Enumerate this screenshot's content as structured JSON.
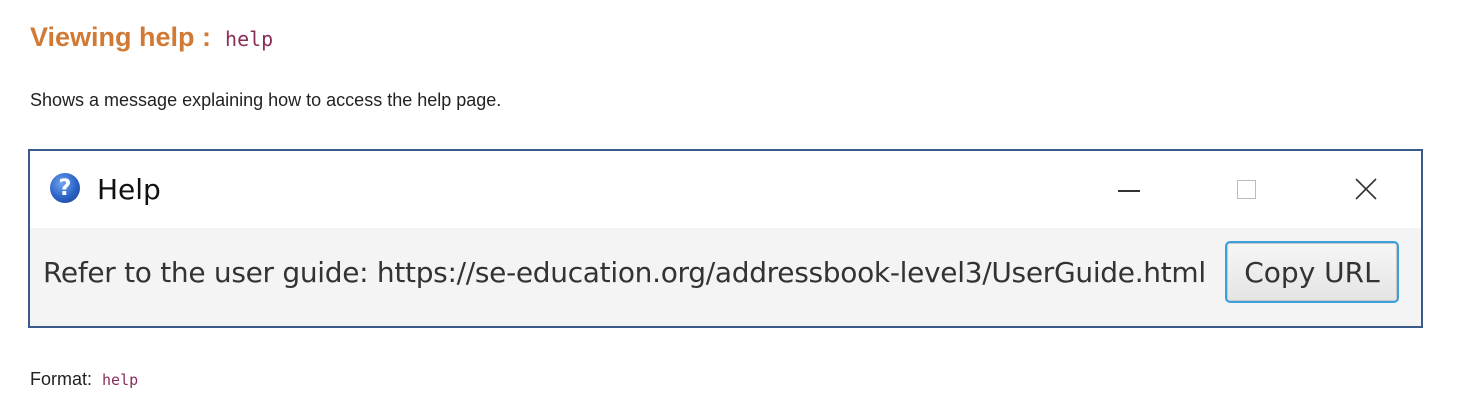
{
  "heading": {
    "title": "Viewing help :",
    "command": "help"
  },
  "description": "Shows a message explaining how to access the help page.",
  "help_window": {
    "icon": "question-mark-icon",
    "title": "Help",
    "controls": {
      "minimize": "minimize-icon",
      "maximize": "maximize-icon",
      "close": "close-icon"
    },
    "message": "Refer to the user guide: https://se-education.org/addressbook-level3/UserGuide.html",
    "copy_button_label": "Copy URL"
  },
  "format": {
    "label": "Format:",
    "command": "help"
  },
  "colors": {
    "heading": "#d07a35",
    "code": "#8b2c5a",
    "window_border": "#3a5a8a",
    "button_focus": "#3aa0da"
  }
}
